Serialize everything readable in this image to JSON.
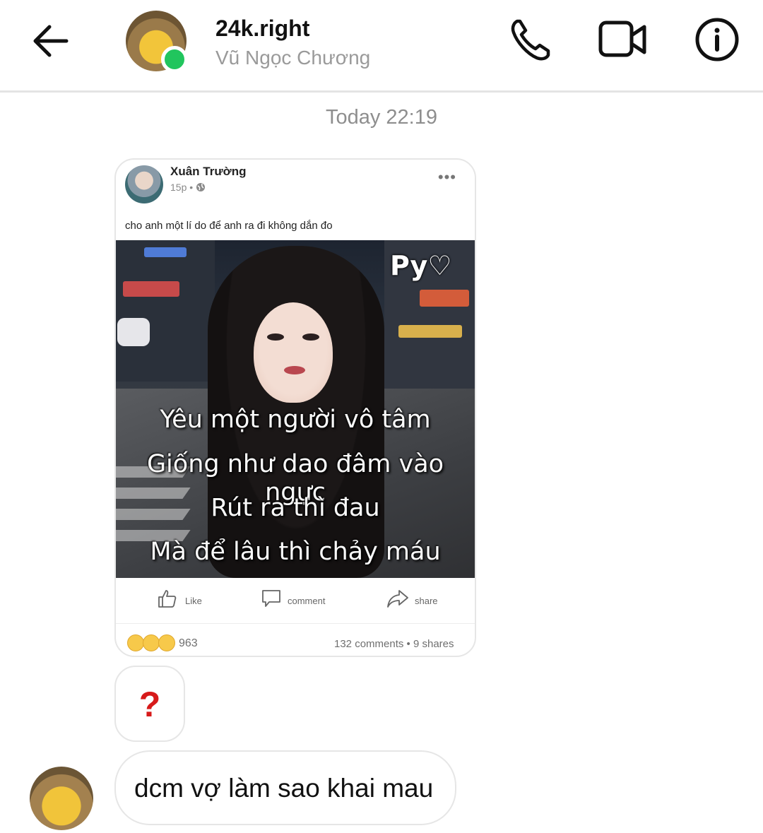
{
  "header": {
    "title": "24k.right",
    "subtitle": "Vũ Ngọc Chương",
    "online": true,
    "icons": [
      "back-arrow-icon",
      "phone-icon",
      "video-camera-icon",
      "info-icon"
    ]
  },
  "chat": {
    "timestamp": "Today 22:19",
    "shared_post": {
      "author": "Xuân Trường",
      "time": "15p",
      "caption": "cho anh một lí do để anh ra đi không dắn đo",
      "image_sign": "Py♡",
      "image_text": [
        "Yêu một người vô tâm",
        "Giống như dao đâm vào ngực",
        "Rút ra thì đau",
        "Mà để lâu thì chảy máu"
      ],
      "actions": {
        "like": "Like",
        "comment": "comment",
        "share": "share"
      },
      "reaction_count": "963",
      "stats_text": "132 comments • 9 shares"
    },
    "question_reply": "?",
    "last_message": "dcm vợ làm sao khai mau"
  },
  "colors": {
    "online": "#21c55d",
    "question": "#d71a1a",
    "accent_text": "#111111"
  }
}
